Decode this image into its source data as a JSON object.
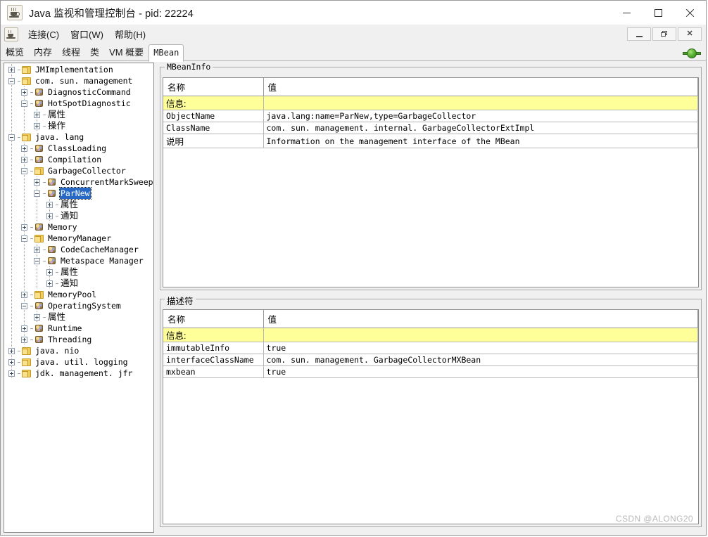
{
  "window": {
    "title": "Java 监视和管理控制台 - pid: 22224",
    "icon": "java-cup-icon",
    "controls": {
      "minimize": "–",
      "maximize": "□",
      "close": "✕"
    }
  },
  "menubar": {
    "icon": "java-cup-icon",
    "items": [
      {
        "label": "连接(C)"
      },
      {
        "label": "窗口(W)"
      },
      {
        "label": "帮助(H)"
      }
    ],
    "mdi_controls": {
      "minimize": "_",
      "restore": "❐",
      "close": "✕"
    }
  },
  "tabs": {
    "items": [
      {
        "label": "概览",
        "selected": false
      },
      {
        "label": "内存",
        "selected": false
      },
      {
        "label": "线程",
        "selected": false
      },
      {
        "label": "类",
        "selected": false
      },
      {
        "label": "VM 概要",
        "selected": false
      },
      {
        "label": "MBean",
        "selected": true
      }
    ],
    "connection_indicator": "connected-green-icon"
  },
  "tree": {
    "nodes": [
      {
        "label": "JMImplementation",
        "depth": 0,
        "toggle": "plus",
        "icon": "folder",
        "selected": false
      },
      {
        "label": "com. sun. management",
        "depth": 0,
        "toggle": "minus",
        "icon": "folder",
        "selected": false
      },
      {
        "label": "DiagnosticCommand",
        "depth": 1,
        "toggle": "plus",
        "icon": "mbean",
        "selected": false
      },
      {
        "label": "HotSpotDiagnostic",
        "depth": 1,
        "toggle": "minus",
        "icon": "mbean",
        "selected": false
      },
      {
        "label": "属性",
        "depth": 2,
        "toggle": "plus",
        "icon": "none",
        "selected": false,
        "cjk": true
      },
      {
        "label": "操作",
        "depth": 2,
        "toggle": "plus",
        "icon": "none",
        "selected": false,
        "cjk": true
      },
      {
        "label": "java. lang",
        "depth": 0,
        "toggle": "minus",
        "icon": "folder",
        "selected": false
      },
      {
        "label": "ClassLoading",
        "depth": 1,
        "toggle": "plus",
        "icon": "mbean",
        "selected": false
      },
      {
        "label": "Compilation",
        "depth": 1,
        "toggle": "plus",
        "icon": "mbean",
        "selected": false
      },
      {
        "label": "GarbageCollector",
        "depth": 1,
        "toggle": "minus",
        "icon": "folder",
        "selected": false
      },
      {
        "label": "ConcurrentMarkSweep",
        "depth": 2,
        "toggle": "plus",
        "icon": "mbean",
        "selected": false
      },
      {
        "label": "ParNew",
        "depth": 2,
        "toggle": "minus",
        "icon": "mbean",
        "selected": true
      },
      {
        "label": "属性",
        "depth": 3,
        "toggle": "plus",
        "icon": "none",
        "selected": false,
        "cjk": true
      },
      {
        "label": "通知",
        "depth": 3,
        "toggle": "plus",
        "icon": "none",
        "selected": false,
        "cjk": true
      },
      {
        "label": "Memory",
        "depth": 1,
        "toggle": "plus",
        "icon": "mbean",
        "selected": false
      },
      {
        "label": "MemoryManager",
        "depth": 1,
        "toggle": "minus",
        "icon": "folder",
        "selected": false
      },
      {
        "label": "CodeCacheManager",
        "depth": 2,
        "toggle": "plus",
        "icon": "mbean",
        "selected": false
      },
      {
        "label": "Metaspace Manager",
        "depth": 2,
        "toggle": "minus",
        "icon": "mbean",
        "selected": false
      },
      {
        "label": "属性",
        "depth": 3,
        "toggle": "plus",
        "icon": "none",
        "selected": false,
        "cjk": true
      },
      {
        "label": "通知",
        "depth": 3,
        "toggle": "plus",
        "icon": "none",
        "selected": false,
        "cjk": true
      },
      {
        "label": "MemoryPool",
        "depth": 1,
        "toggle": "plus",
        "icon": "folder",
        "selected": false
      },
      {
        "label": "OperatingSystem",
        "depth": 1,
        "toggle": "minus",
        "icon": "mbean",
        "selected": false
      },
      {
        "label": "属性",
        "depth": 2,
        "toggle": "plus",
        "icon": "none",
        "selected": false,
        "cjk": true
      },
      {
        "label": "Runtime",
        "depth": 1,
        "toggle": "plus",
        "icon": "mbean",
        "selected": false
      },
      {
        "label": "Threading",
        "depth": 1,
        "toggle": "plus",
        "icon": "mbean",
        "selected": false
      },
      {
        "label": "java. nio",
        "depth": 0,
        "toggle": "plus",
        "icon": "folder",
        "selected": false
      },
      {
        "label": "java. util. logging",
        "depth": 0,
        "toggle": "plus",
        "icon": "folder",
        "selected": false
      },
      {
        "label": "jdk. management. jfr",
        "depth": 0,
        "toggle": "plus",
        "icon": "folder",
        "selected": false
      }
    ]
  },
  "mbeaninfo": {
    "title": "MBeanInfo",
    "columns": [
      "名称",
      "值"
    ],
    "rows": [
      {
        "name": "信息:",
        "value": "",
        "highlight": true,
        "cjk": true
      },
      {
        "name": "ObjectName",
        "value": "java.lang:name=ParNew,type=GarbageCollector",
        "highlight": false
      },
      {
        "name": "ClassName",
        "value": "com. sun. management. internal. GarbageCollectorExtImpl",
        "highlight": false
      },
      {
        "name": "说明",
        "value": "Information on the management interface of the MBean",
        "highlight": false,
        "cjk": true
      }
    ]
  },
  "descriptors": {
    "title": "描述符",
    "columns": [
      "名称",
      "值"
    ],
    "rows": [
      {
        "name": "信息:",
        "value": "",
        "highlight": true,
        "cjk": true
      },
      {
        "name": "immutableInfo",
        "value": "true",
        "highlight": false
      },
      {
        "name": "interfaceClassName",
        "value": "com. sun. management. GarbageCollectorMXBean",
        "highlight": false
      },
      {
        "name": "mxbean",
        "value": "true",
        "highlight": false
      }
    ]
  },
  "watermark": "CSDN @ALONG20",
  "colors": {
    "selection": "#2668c4",
    "highlight_row": "#ffff99",
    "folder": "#f0cc5e",
    "connected": "#62b939"
  }
}
